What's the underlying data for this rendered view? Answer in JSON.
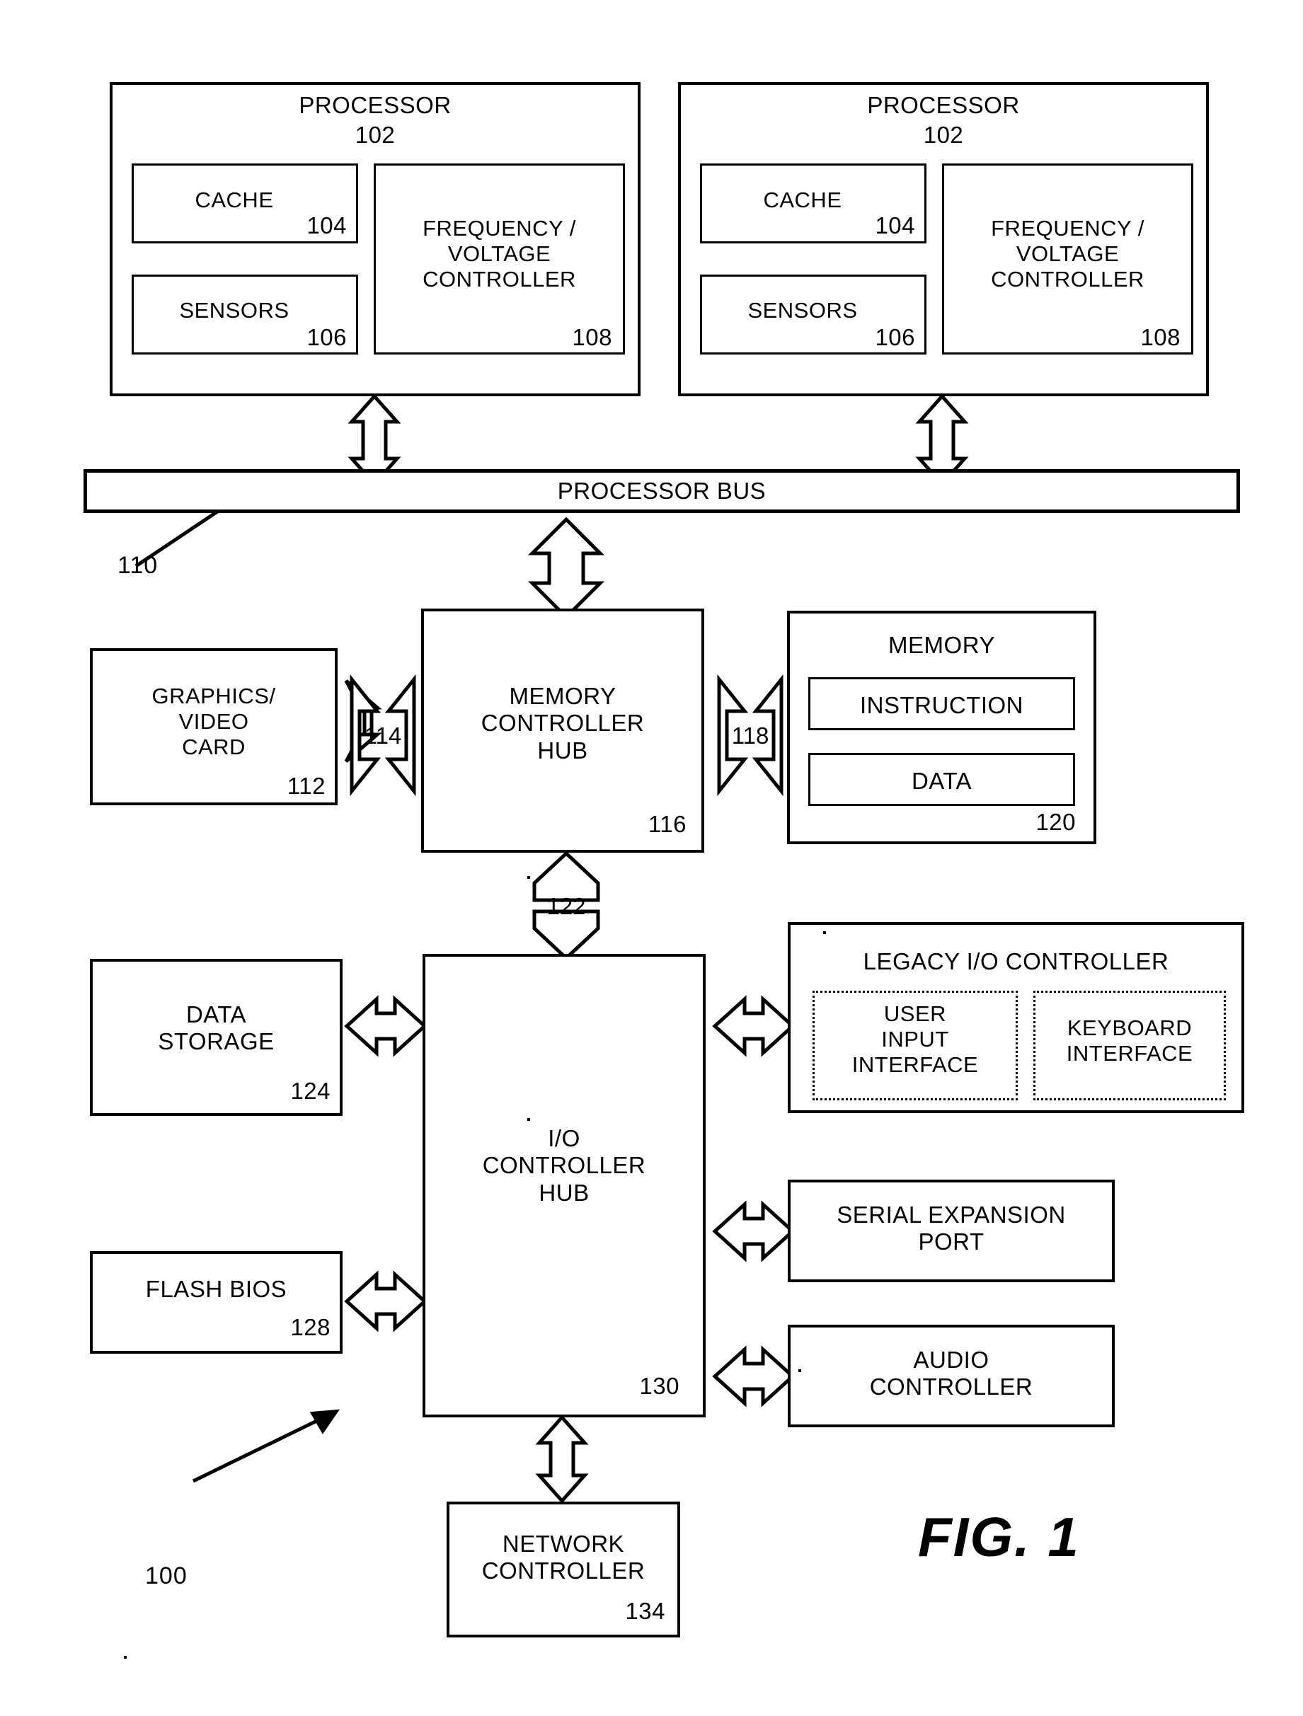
{
  "figure": {
    "caption": "FIG. 1",
    "system_ref": "100"
  },
  "processors": [
    {
      "title": "PROCESSOR",
      "ref": "102",
      "cache": {
        "title": "CACHE",
        "ref": "104"
      },
      "sensors": {
        "title": "SENSORS",
        "ref": "106"
      },
      "fvc": {
        "title": "FREQUENCY /\nVOLTAGE\nCONTROLLER",
        "ref": "108"
      }
    },
    {
      "title": "PROCESSOR",
      "ref": "102",
      "cache": {
        "title": "CACHE",
        "ref": "104"
      },
      "sensors": {
        "title": "SENSORS",
        "ref": "106"
      },
      "fvc": {
        "title": "FREQUENCY /\nVOLTAGE\nCONTROLLER",
        "ref": "108"
      }
    }
  ],
  "bus": {
    "label": "PROCESSOR BUS",
    "ref": "110"
  },
  "graphics_card": {
    "title": "GRAPHICS/\nVIDEO\nCARD",
    "ref": "112"
  },
  "memory_controller_hub": {
    "title": "MEMORY\nCONTROLLER\nHUB",
    "ref": "116"
  },
  "memory": {
    "title": "MEMORY",
    "ref": "120",
    "instruction": "INSTRUCTION",
    "data": "DATA"
  },
  "io_controller_hub": {
    "title": "I/O\nCONTROLLER\nHUB",
    "ref": "130"
  },
  "data_storage": {
    "title": "DATA\nSTORAGE",
    "ref": "124"
  },
  "flash_bios": {
    "title": "FLASH BIOS",
    "ref": "128"
  },
  "legacy_io_controller": {
    "title": "LEGACY I/O CONTROLLER",
    "user_input_interface": "USER\nINPUT\nINTERFACE",
    "keyboard_interface": "KEYBOARD\nINTERFACE"
  },
  "serial_expansion_port": {
    "title": "SERIAL EXPANSION\nPORT"
  },
  "audio_controller": {
    "title": "AUDIO\nCONTROLLER"
  },
  "network_controller": {
    "title": "NETWORK\nCONTROLLER",
    "ref": "134"
  },
  "interconnect_labels": {
    "graphics_link": "114",
    "memory_link": "118",
    "hub_link": "122"
  }
}
